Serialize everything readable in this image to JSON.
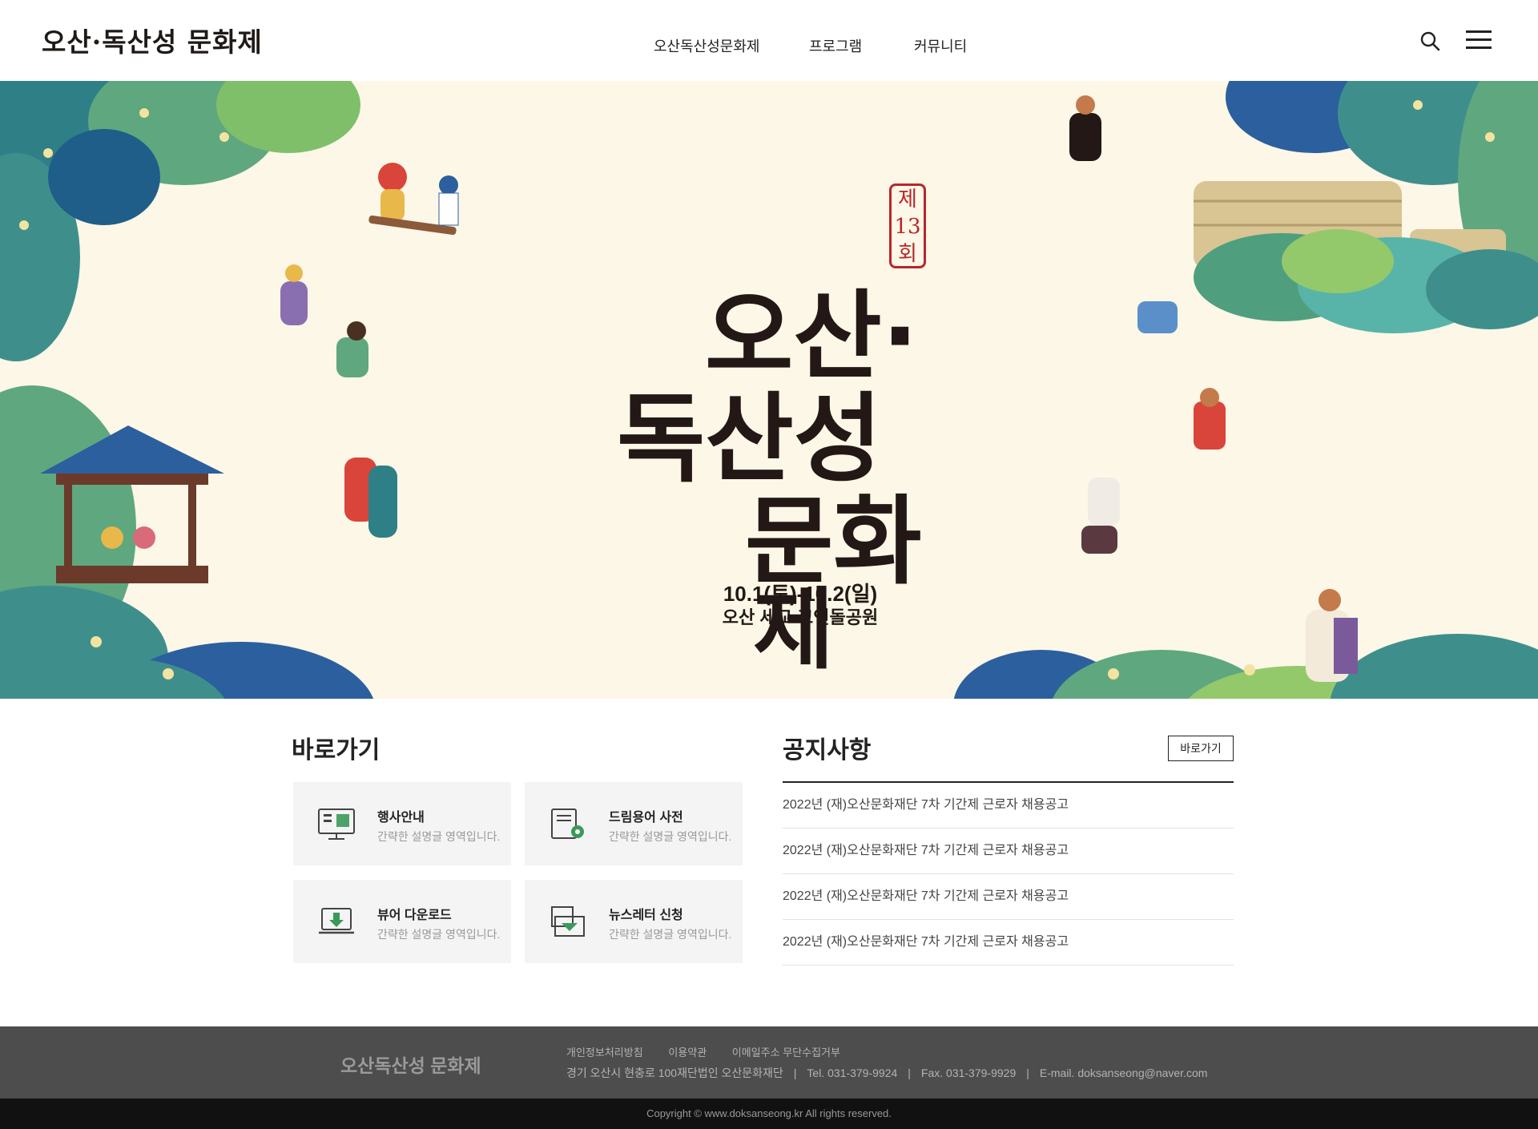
{
  "header": {
    "logo_text": "오산·독산성 문화제",
    "nav": [
      "오산독산성문화제",
      "프로그램",
      "커뮤니티"
    ]
  },
  "hero": {
    "title_lines": [
      "오산·",
      "독산성",
      "문화",
      "제"
    ],
    "edition": "제13회",
    "date": "10.1(토)-10.2(일)",
    "place": "오산 세교 고인돌공원"
  },
  "quick": {
    "title": "바로가기",
    "cards": [
      {
        "title": "행사안내",
        "desc": "간략한 설명글 영역입니다.",
        "icon": "monitor-icon"
      },
      {
        "title": "드림용어 사전",
        "desc": "간략한 설명글 영역입니다.",
        "icon": "dictionary-icon"
      },
      {
        "title": "뷰어 다운로드",
        "desc": "간략한 설명글 영역입니다.",
        "icon": "download-icon"
      },
      {
        "title": "뉴스레터 신청",
        "desc": "간략한 설명글 영역입니다.",
        "icon": "newsletter-icon"
      }
    ]
  },
  "notice": {
    "title": "공지사항",
    "more_label": "바로가기",
    "items": [
      "2022년 (재)오산문화재단 7차 기간제 근로자 채용공고",
      "2022년 (재)오산문화재단 7차 기간제 근로자 채용공고",
      "2022년 (재)오산문화재단 7차 기간제 근로자 채용공고",
      "2022년 (재)오산문화재단 7차 기간제 근로자 채용공고"
    ]
  },
  "footer": {
    "logo_text": "오산독산성 문화제",
    "links": [
      "개인정보처리방침",
      "이용약관",
      "이메일주소 무단수집거부"
    ],
    "address": "경기 오산시 현충로 100재단법인 오산문화재단",
    "tel": "Tel. 031-379-9924",
    "fax": "Fax. 031-379-9929",
    "email": "E-mail. doksanseong@naver.com",
    "copyright": "Copyright © www.doksanseong.kr All rights reserved."
  },
  "colors": {
    "accent": "#3a9a5b",
    "hero_bg": "#fcf7e6",
    "stamp": "#b8262b",
    "footer_bg": "#4d4d4d"
  }
}
